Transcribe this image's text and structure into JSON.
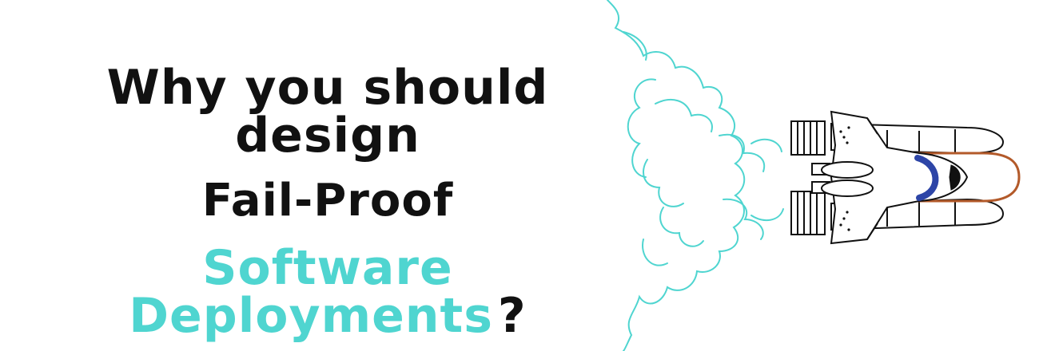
{
  "headline": {
    "line1": "Why you should design",
    "line2": "Fail-Proof",
    "line3": "Software Deployments",
    "question_mark": "?"
  },
  "colors": {
    "text_dark": "#111111",
    "accent_cyan": "#4fd5d0",
    "shuttle_blue": "#2d45a7",
    "tank_orange": "#b35a2a"
  }
}
